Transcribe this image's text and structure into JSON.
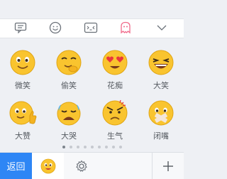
{
  "categories": [
    {
      "icon": "message-icon",
      "active": false
    },
    {
      "icon": "smiley-icon",
      "active": false
    },
    {
      "icon": "kaomoji-icon",
      "active": false
    },
    {
      "icon": "ghost-icon",
      "active": true
    },
    {
      "icon": "chevron-down-icon",
      "active": false
    }
  ],
  "emojis": [
    {
      "label": "微笑",
      "icon": "smile-emoji-icon"
    },
    {
      "label": "偷笑",
      "icon": "snicker-emoji-icon"
    },
    {
      "label": "花痴",
      "icon": "heart-eyes-emoji-icon"
    },
    {
      "label": "大笑",
      "icon": "laugh-emoji-icon"
    },
    {
      "label": "大赞",
      "icon": "thumbs-up-emoji-icon"
    },
    {
      "label": "大哭",
      "icon": "crying-emoji-icon"
    },
    {
      "label": "生气",
      "icon": "angry-emoji-icon"
    },
    {
      "label": "闭嘴",
      "icon": "shut-up-emoji-icon"
    }
  ],
  "pager": {
    "total": 9,
    "active": 0
  },
  "bottom": {
    "back_label": "返回",
    "add_label": "+"
  },
  "colors": {
    "accent": "#2e86f5",
    "category_active": "#f06a8a",
    "emoji_face": "#f9c42f"
  }
}
